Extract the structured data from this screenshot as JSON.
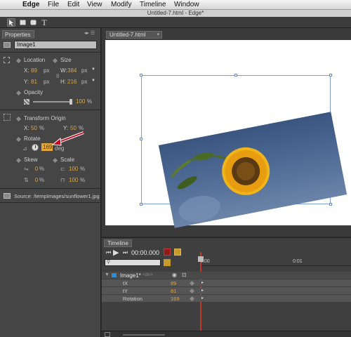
{
  "menubar": {
    "apple": "",
    "app_name": "Edge",
    "items": [
      "File",
      "Edit",
      "View",
      "Modify",
      "Timeline",
      "Window"
    ]
  },
  "window": {
    "title": "Untitled-7.html - Edge*"
  },
  "toolbar": {
    "tools": [
      "select-arrow-icon",
      "rectangle-icon",
      "rounded-rectangle-icon",
      "text-icon"
    ],
    "text_tool_glyph": "T"
  },
  "properties": {
    "tab_label": "Properties",
    "element_name": "Image1",
    "location": {
      "label": "Location",
      "x_label": "X:",
      "x": "89",
      "x_unit": "px",
      "y_label": "Y:",
      "y": "81",
      "y_unit": "px"
    },
    "size": {
      "label": "Size",
      "w_label": "W:",
      "w": "384",
      "w_unit": "px",
      "h_label": "H:",
      "h": "216",
      "h_unit": "px"
    },
    "opacity": {
      "label": "Opacity",
      "value": "100",
      "unit": "%",
      "level": 1.0
    },
    "transform_origin": {
      "label": "Transform Origin",
      "x_label": "X:",
      "x": "50",
      "x_unit": "%",
      "y_label": "Y:",
      "y": "50",
      "y_unit": "%"
    },
    "rotate": {
      "label": "Rotate",
      "value": "169",
      "unit": "deg"
    },
    "skew": {
      "label": "Skew",
      "x": "0",
      "x_unit": "%",
      "y": "0",
      "y_unit": "%"
    },
    "scale": {
      "label": "Scale",
      "x": "100",
      "x_unit": "%",
      "y": "100",
      "y_unit": "%"
    },
    "source": "Source: /tempImages/sunflower1.jpg"
  },
  "document": {
    "tab_label": "Untitled-7.html"
  },
  "timeline": {
    "tab_label": "Timeline",
    "time": "00:00.000",
    "ticks": [
      "0:00",
      "0:01"
    ],
    "element": {
      "name": "Image1*",
      "tag": "<div>"
    },
    "props": [
      {
        "name": "tX",
        "value": "89"
      },
      {
        "name": "tY",
        "value": "81"
      },
      {
        "name": "Rotation",
        "value": "169"
      }
    ]
  },
  "colors": {
    "accent": "#e2a736",
    "selection": "#7c9cdd",
    "playhead": "#c0392b",
    "arrow": "#d0021b"
  }
}
